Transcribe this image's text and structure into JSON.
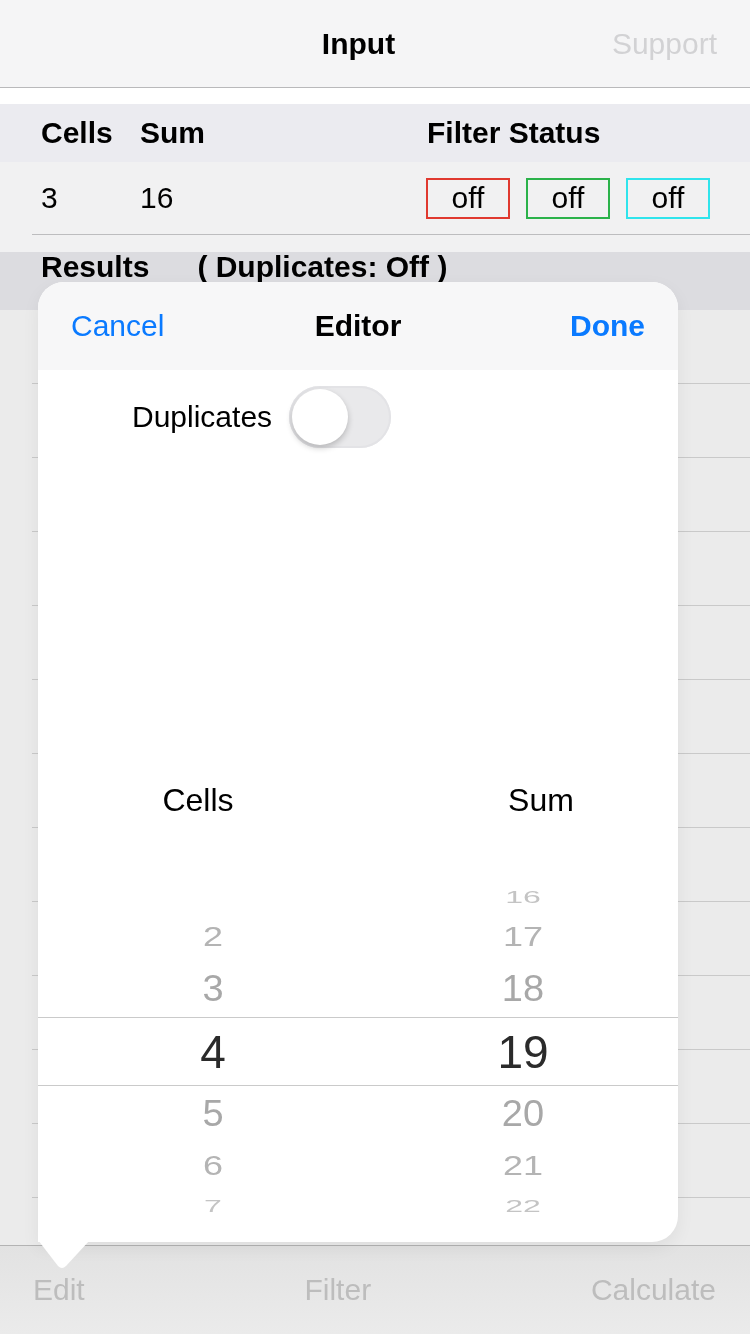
{
  "nav_bar": {
    "title": "Input",
    "action": "Support"
  },
  "input_table": {
    "columns": [
      "Cells",
      "Sum",
      "Filter Status"
    ],
    "row": {
      "cells": "3",
      "sum": "16",
      "filters": [
        {
          "label": "off",
          "color": "#e0392f"
        },
        {
          "label": "off",
          "color": "#2bb24a"
        },
        {
          "label": "off",
          "color": "#2fe4ec"
        }
      ]
    }
  },
  "results": {
    "title": "Results",
    "duplicates_status": "( Duplicates: Off )"
  },
  "editor": {
    "cancel": "Cancel",
    "title": "Editor",
    "done": "Done",
    "duplicates": {
      "label": "Duplicates",
      "on": false
    },
    "pickers": [
      {
        "label": "Cells",
        "items": [
          {
            "value": "2",
            "selected": false
          },
          {
            "value": "3",
            "selected": false
          },
          {
            "value": "4",
            "selected": true
          },
          {
            "value": "5",
            "selected": false
          },
          {
            "value": "6",
            "selected": false
          },
          {
            "value": "7",
            "selected": false
          }
        ]
      },
      {
        "label": "Sum",
        "items": [
          {
            "value": "16",
            "selected": false
          },
          {
            "value": "17",
            "selected": false
          },
          {
            "value": "18",
            "selected": false
          },
          {
            "value": "19",
            "selected": true
          },
          {
            "value": "20",
            "selected": false
          },
          {
            "value": "21",
            "selected": false
          },
          {
            "value": "22",
            "selected": false
          }
        ]
      }
    ]
  },
  "toolbar": {
    "items": [
      "Edit",
      "Filter",
      "Calculate"
    ]
  }
}
